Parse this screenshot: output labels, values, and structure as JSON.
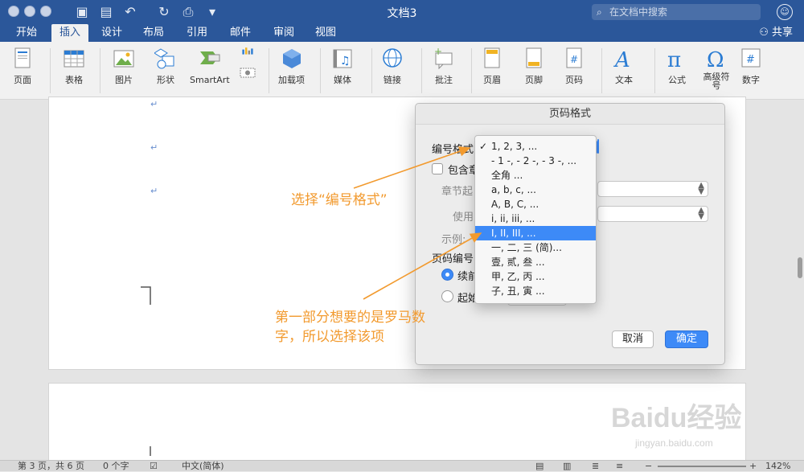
{
  "window": {
    "title": "文档3",
    "search_placeholder": "在文档中搜索"
  },
  "tabs": [
    "开始",
    "插入",
    "设计",
    "布局",
    "引用",
    "邮件",
    "审阅",
    "视图"
  ],
  "active_tab": "插入",
  "share_label": "共享",
  "ribbon": [
    "页面",
    "表格",
    "图片",
    "形状",
    "SmartArt",
    "加载项",
    "媒体",
    "链接",
    "批注",
    "页眉",
    "页脚",
    "页码",
    "文本",
    "公式",
    "高级符号",
    "数字"
  ],
  "dialog": {
    "title": "页码格式",
    "number_format_label": "编号格式",
    "include_chapter_label": "包含章",
    "chapter_start_label": "章节起",
    "use_separator_label": "使用",
    "example_label": "示例:",
    "page_numbering_label": "页码编号",
    "continue_label": "续前",
    "start_at_label": "起始",
    "cancel_label": "取消",
    "ok_label": "确定"
  },
  "number_formats": [
    "1, 2, 3, ...",
    "- 1 -, - 2 -, - 3 -, ...",
    "全角 ...",
    "a, b, c, ...",
    "A, B, C, ...",
    "i, ii, iii, ...",
    "I, II, III, ...",
    "一, 二, 三 (简)...",
    "壹, 贰, 叁 ...",
    "甲, 乙, 丙 ...",
    "子, 丑, 寅 ..."
  ],
  "checked_format": "1, 2, 3, ...",
  "highlighted_format": "I, II, III, ...",
  "annotations": {
    "a1": "选择“编号格式”",
    "a2_line1": "第一部分想要的是罗马数",
    "a2_line2": "字，所以选择该项"
  },
  "status": {
    "page": "第 3 页，共 6 页",
    "words": "0 个字",
    "lang": "中文(简体)",
    "zoom": "142%"
  },
  "watermark": {
    "brand": "Baidu经验",
    "url": "jingyan.baidu.com"
  },
  "colors": {
    "accent": "#2b579a",
    "highlight": "#3d8af7",
    "annotation": "#f29a2e"
  }
}
